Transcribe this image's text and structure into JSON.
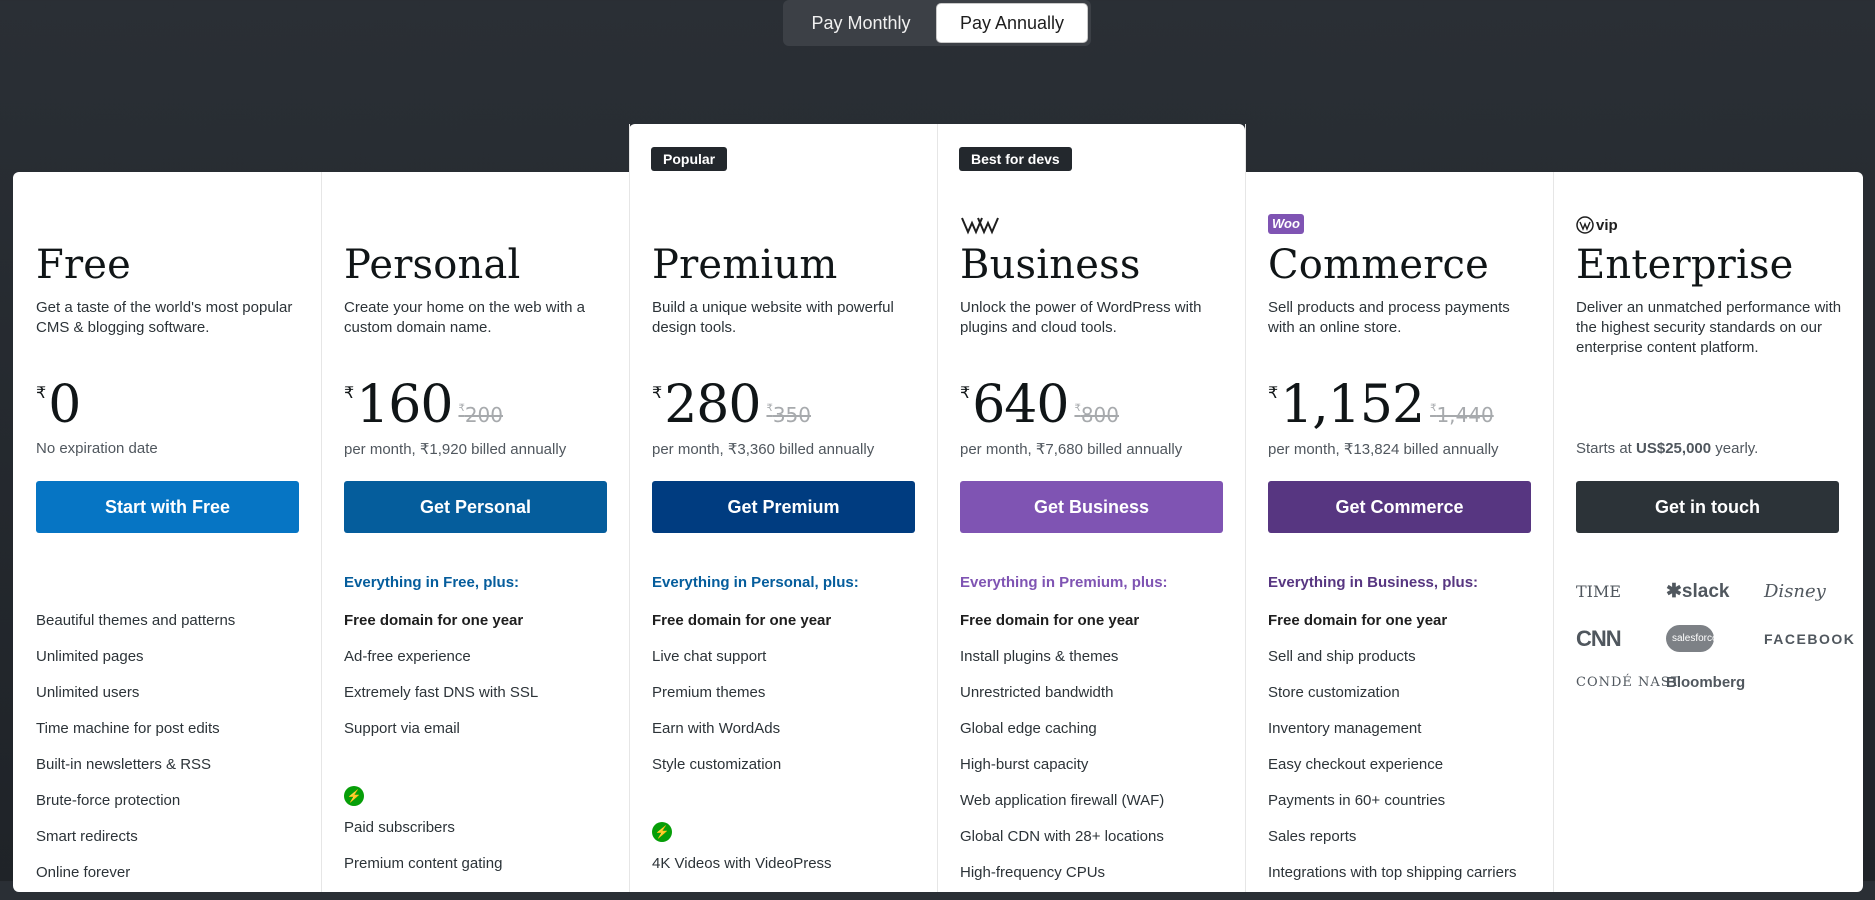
{
  "billing_toggle": {
    "monthly_label": "Pay Monthly",
    "annual_label": "Pay Annually",
    "selected": "annual"
  },
  "colors": {
    "page_background": "#23282d",
    "free": "#0675c4",
    "personal": "#055d9c",
    "premium": "#003c80",
    "business": "#7f54b3",
    "commerce": "#573681",
    "enterprise": "#2c3338"
  },
  "plans": [
    {
      "name": "Free",
      "description": "Get a taste of the world's most popular CMS & blogging software.",
      "currency": "₹",
      "price": "0",
      "old_price": "",
      "price_note": "No expiration date",
      "cta": "Start with Free",
      "plus_label": "",
      "features": [
        "Beautiful themes and patterns",
        "Unlimited pages",
        "Unlimited users",
        "Time machine for post edits",
        "Built-in newsletters & RSS",
        "Brute-force protection",
        "Smart redirects",
        "Online forever"
      ]
    },
    {
      "name": "Personal",
      "description": "Create your home on the web with a custom domain name.",
      "currency": "₹",
      "price": "160",
      "old_price": "200",
      "price_note": "per month, ₹1,920 billed annually",
      "cta": "Get Personal",
      "plus_label": "Everything in Free, plus:",
      "features": [
        "Free domain for one year",
        "Ad-free experience",
        "Extremely fast DNS with SSL",
        "Support via email"
      ],
      "extra_features": [
        "Paid subscribers",
        "Premium content gating"
      ]
    },
    {
      "name": "Premium",
      "badge": "Popular",
      "description": "Build a unique website with powerful design tools.",
      "currency": "₹",
      "price": "280",
      "old_price": "350",
      "price_note": "per month, ₹3,360 billed annually",
      "cta": "Get Premium",
      "plus_label": "Everything in Personal, plus:",
      "features": [
        "Free domain for one year",
        "Live chat support",
        "Premium themes",
        "Earn with WordAds",
        "Style customization"
      ],
      "extra_features": [
        "4K Videos with VideoPress"
      ]
    },
    {
      "name": "Business",
      "badge": "Best for devs",
      "logo": "wp-logo-icon",
      "description": "Unlock the power of WordPress with plugins and cloud tools.",
      "currency": "₹",
      "price": "640",
      "old_price": "800",
      "price_note": "per month, ₹7,680 billed annually",
      "cta": "Get Business",
      "plus_label": "Everything in Premium, plus:",
      "features": [
        "Free domain for one year",
        "Install plugins & themes",
        "Unrestricted bandwidth",
        "Global edge caching",
        "High-burst capacity",
        "Web application firewall (WAF)",
        "Global CDN with 28+ locations",
        "High-frequency CPUs"
      ]
    },
    {
      "name": "Commerce",
      "logo_text": "Woo",
      "description": "Sell products and process payments with an online store.",
      "currency": "₹",
      "price": "1,152",
      "old_price": "1,440",
      "price_note": "per month, ₹13,824 billed annually",
      "cta": "Get Commerce",
      "plus_label": "Everything in Business, plus:",
      "features": [
        "Free domain for one year",
        "Sell and ship products",
        "Store customization",
        "Inventory management",
        "Easy checkout experience",
        "Payments in 60+ countries",
        "Sales reports",
        "Integrations with top shipping carriers"
      ]
    },
    {
      "name": "Enterprise",
      "logo_text": "vip",
      "description": "Deliver an unmatched performance with the highest security standards on our enterprise content platform.",
      "price_note_prefix": "Starts at ",
      "price_note_amount": "US$25,000",
      "price_note_suffix": " yearly.",
      "cta": "Get in touch",
      "clients": [
        "TIME",
        "slack",
        "Disney",
        "CNN",
        "salesforce",
        "FACEBOOK",
        "CONDÉ NAST",
        "Bloomberg"
      ]
    }
  ]
}
